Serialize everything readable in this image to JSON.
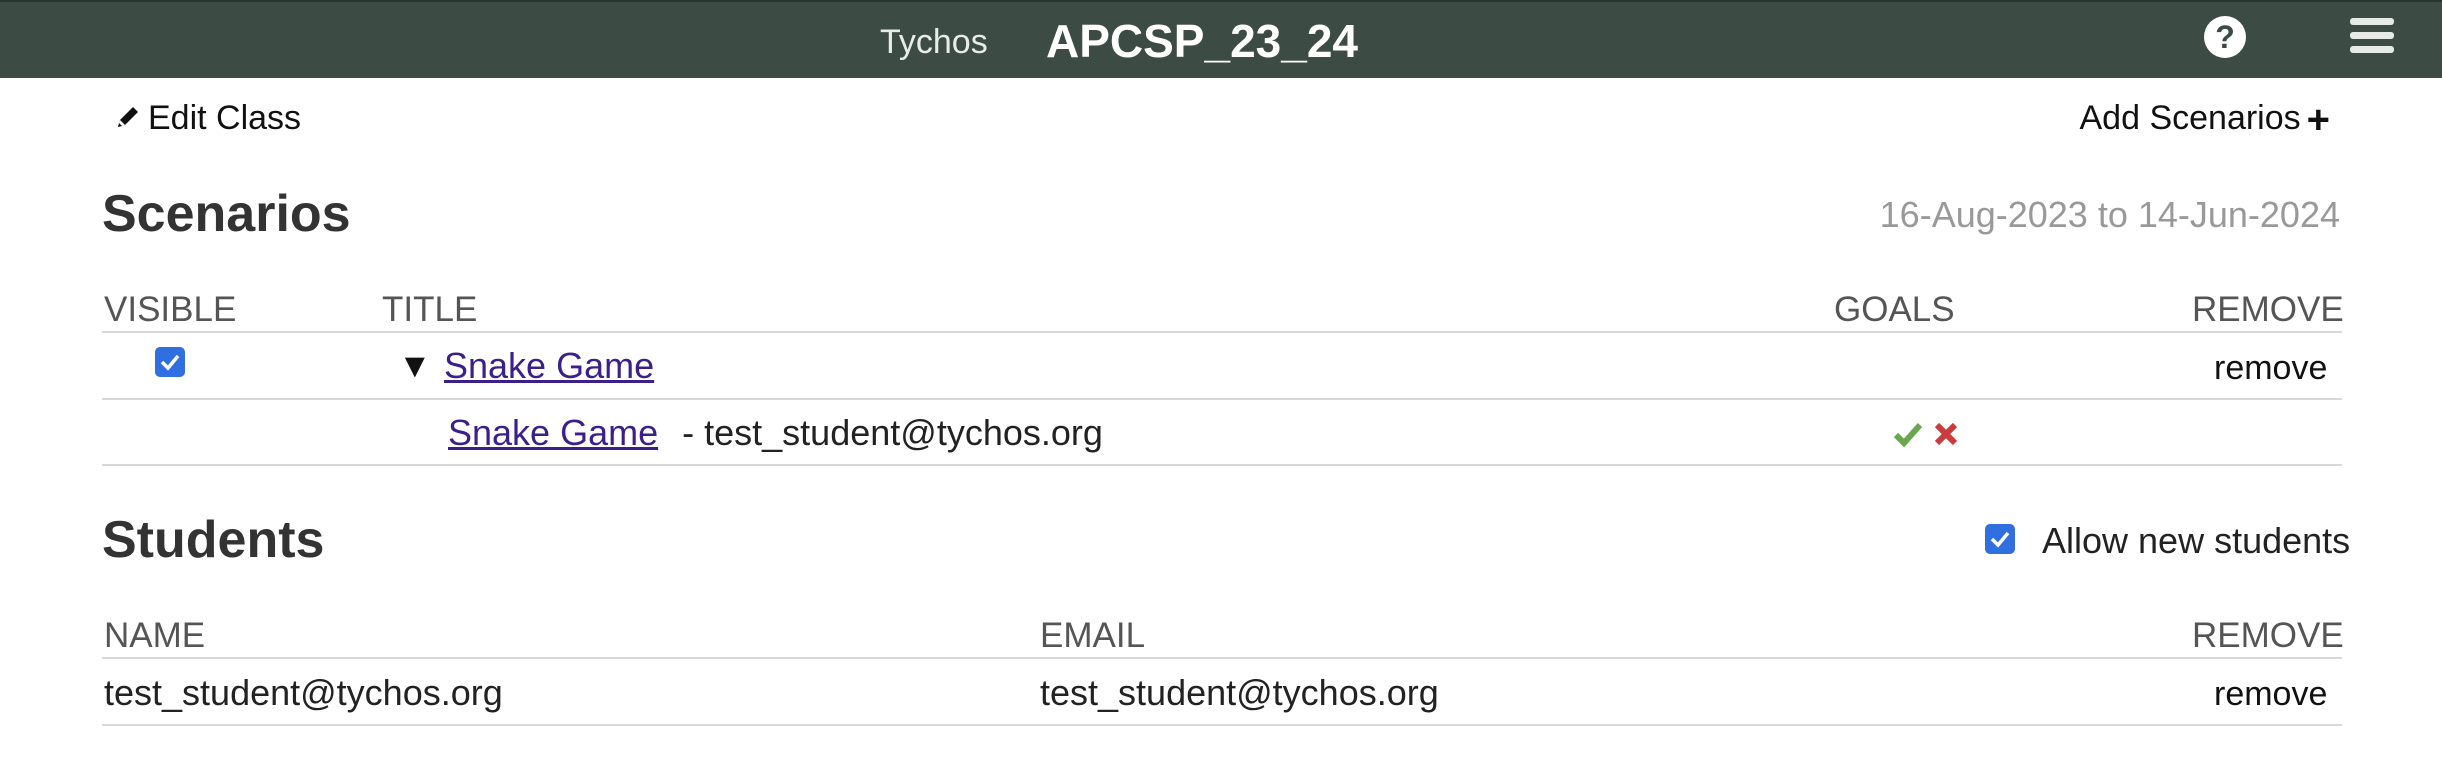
{
  "header": {
    "brand": "Tychos",
    "class_name": "APCSP_23_24",
    "help_icon": "?"
  },
  "toolbar": {
    "edit_class_label": "Edit Class",
    "add_scenarios_label": "Add Scenarios"
  },
  "scenarios": {
    "heading": "Scenarios",
    "date_range": "16-Aug-2023 to 14-Jun-2024",
    "columns": {
      "visible": "VISIBLE",
      "title": "TITLE",
      "goals": "GOALS",
      "remove": "REMOVE"
    },
    "rows": [
      {
        "visible": true,
        "title": "Snake Game",
        "remove_label": "remove"
      }
    ],
    "submission": {
      "title": "Snake Game",
      "student": "- test_student@tychos.org",
      "goal_pass_color": "#6aa84f",
      "goal_fail_color": "#cc3b3b"
    }
  },
  "students": {
    "heading": "Students",
    "allow_new_label": "Allow new students",
    "allow_new_checked": true,
    "columns": {
      "name": "NAME",
      "email": "EMAIL",
      "remove": "REMOVE"
    },
    "rows": [
      {
        "name": "test_student@tychos.org",
        "email": "test_student@tychos.org",
        "remove_label": "remove"
      }
    ]
  }
}
